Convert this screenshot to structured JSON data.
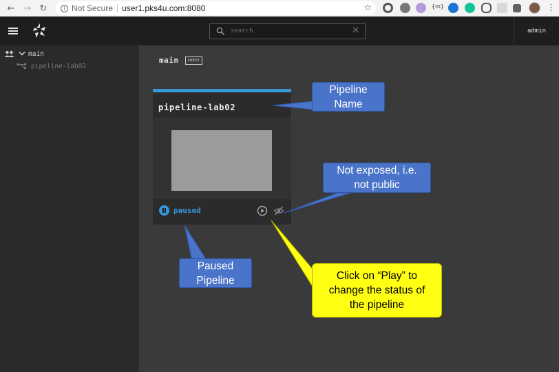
{
  "browser": {
    "security_label": "Not Secure",
    "url": "user1.pks4u.com:8080",
    "extension_badge": "{m}"
  },
  "topbar": {
    "search_placeholder": "search",
    "username": "admin"
  },
  "sidebar": {
    "team": "main",
    "pipelines": [
      "pipeline-lab02"
    ]
  },
  "dashboard": {
    "team_name": "main",
    "team_badge": "OWNER",
    "card": {
      "pipeline_name": "pipeline-lab02",
      "status": "paused",
      "accent_color": "#3498db"
    }
  },
  "annotations": {
    "pipeline_name": [
      "Pipeline",
      "Name"
    ],
    "not_exposed": [
      "Not exposed, i.e.",
      "not public"
    ],
    "paused": [
      "Paused",
      "Pipeline"
    ],
    "play": [
      "Click on “Play” to",
      "change the status of",
      "the pipeline"
    ]
  }
}
